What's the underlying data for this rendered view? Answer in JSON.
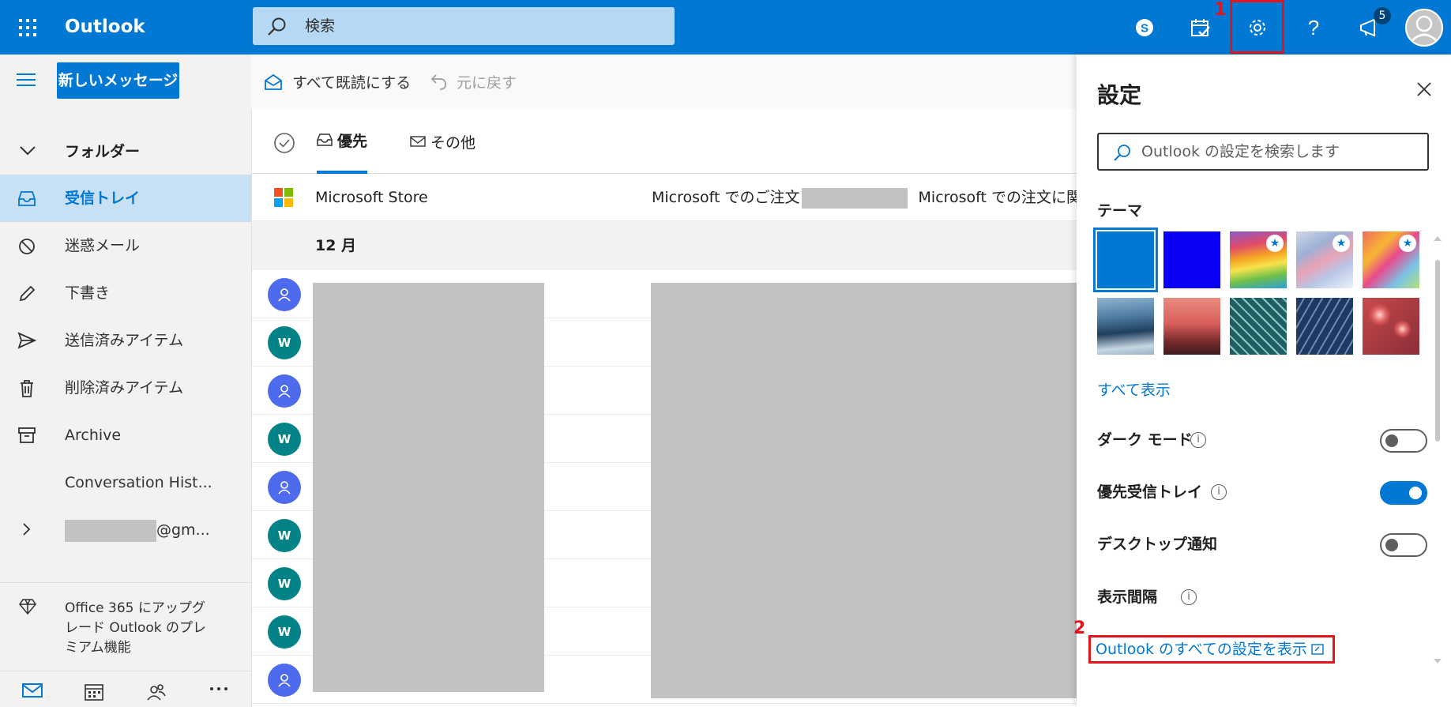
{
  "app": {
    "name": "Outlook"
  },
  "search": {
    "placeholder": "検索"
  },
  "topbar": {
    "notification_count": "5"
  },
  "nav": {
    "new_message": "新しいメッセージ",
    "folders_label": "フォルダー",
    "items": [
      {
        "label": "受信トレイ",
        "icon": "inbox-icon",
        "selected": true
      },
      {
        "label": "迷惑メール",
        "icon": "junk-icon"
      },
      {
        "label": "下書き",
        "icon": "pencil-icon"
      },
      {
        "label": "送信済みアイテム",
        "icon": "send-icon"
      },
      {
        "label": "削除済みアイテム",
        "icon": "trash-icon"
      },
      {
        "label": "Archive",
        "icon": "archive-icon"
      },
      {
        "label": "Conversation Hist..."
      }
    ],
    "account_suffix": "@gm...",
    "upgrade_text": "Office 365 にアップグレード Outlook のプレミアム機能"
  },
  "commands": {
    "mark_all_read": "すべて既読にする",
    "undo": "元に戻す"
  },
  "pivots": {
    "focused": "優先",
    "other": "その他"
  },
  "messages": {
    "first": {
      "sender": "Microsoft Store",
      "subject_a": "Microsoft でのご注文",
      "subject_b": "Microsoft での注文に関"
    },
    "group_header": "12 月",
    "avatars": [
      "person",
      "W",
      "person",
      "W",
      "person",
      "W",
      "W",
      "W",
      "person"
    ]
  },
  "settings": {
    "title": "設定",
    "search_placeholder": "Outlook の設定を検索します",
    "theme_label": "テーマ",
    "show_all": "すべて表示",
    "dark_mode": "ダーク モード",
    "focused_inbox": "優先受信トレイ",
    "desktop_notifications": "デスクトップ通知",
    "display_density": "表示間隔",
    "view_all_settings": "Outlook のすべての設定を表示",
    "toggles": {
      "dark_mode": false,
      "focused_inbox": true,
      "desktop_notifications": false
    }
  },
  "annotations": {
    "marker_1": "1",
    "marker_2": "2"
  },
  "colors": {
    "accent": "#0078d4",
    "highlight": "#e4141c",
    "avatar_person": "#4f6bed",
    "avatar_w": "#038387"
  }
}
